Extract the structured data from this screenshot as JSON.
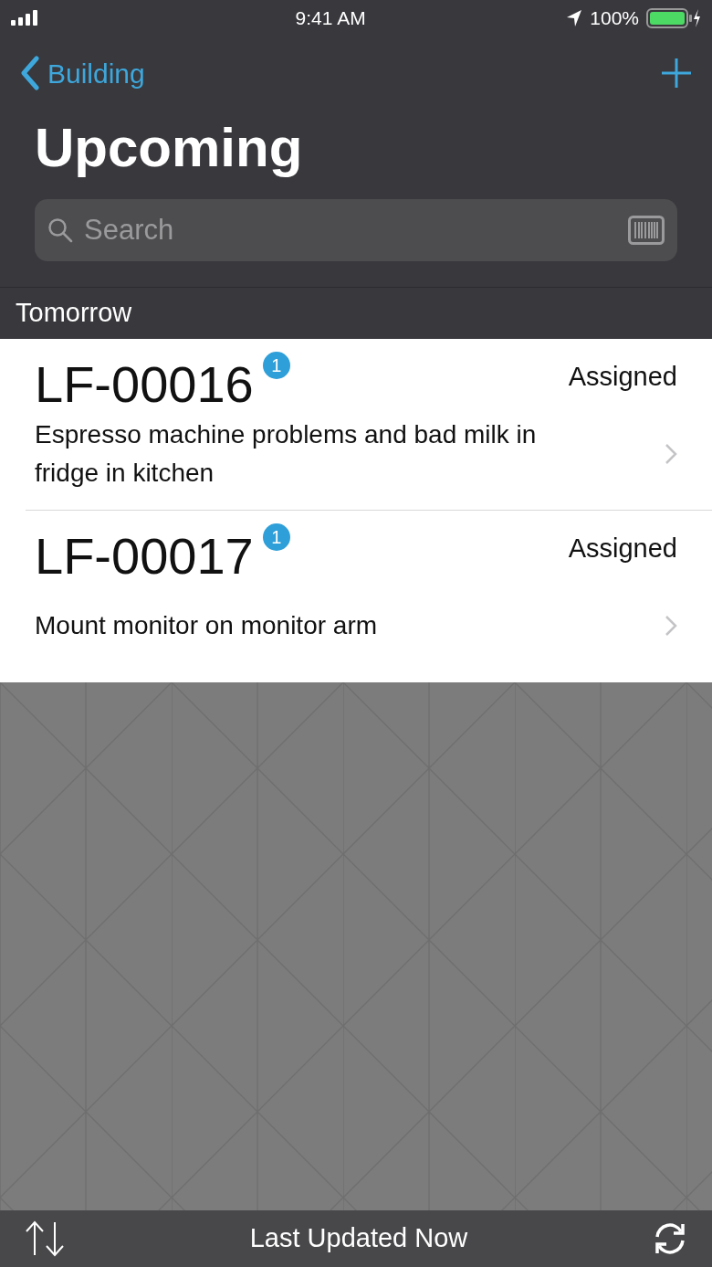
{
  "status_bar": {
    "time": "9:41 AM",
    "battery": "100%"
  },
  "nav": {
    "back": "Building"
  },
  "title": "Upcoming",
  "search": {
    "placeholder": "Search"
  },
  "section": "Tomorrow",
  "items": [
    {
      "id": "LF-00016",
      "badge": "1",
      "status": "Assigned",
      "description": "Espresso machine problems and bad milk in fridge in kitchen"
    },
    {
      "id": "LF-00017",
      "badge": "1",
      "status": "Assigned",
      "description": "Mount monitor on monitor arm"
    }
  ],
  "footer": {
    "text": "Last Updated Now"
  }
}
